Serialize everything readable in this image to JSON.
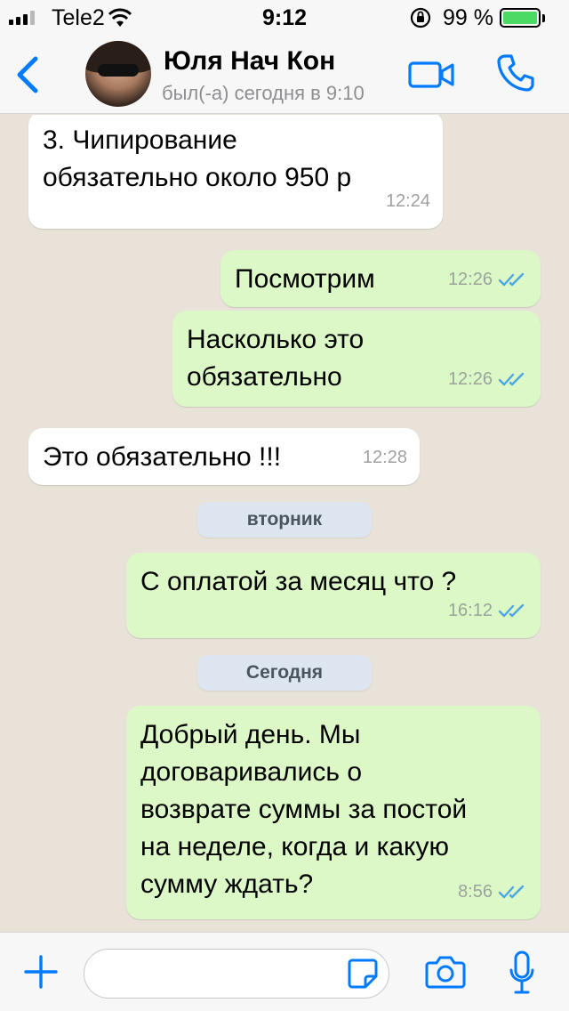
{
  "status_bar": {
    "carrier": "Tele2",
    "time": "9:12",
    "battery_percent": "99 %",
    "battery_level": 0.99
  },
  "header": {
    "contact_name": "Юля Нач Кон",
    "contact_status": "был(-а) сегодня в 9:10"
  },
  "messages": [
    {
      "direction": "in",
      "text": "3. Чипирование\nобязательно около 950 р",
      "time": "12:24"
    },
    {
      "direction": "out",
      "text": "Посмотрим",
      "time": "12:26",
      "read": true
    },
    {
      "direction": "out",
      "text": "Насколько это\nобязательно",
      "time": "12:26",
      "read": true
    },
    {
      "direction": "in",
      "text": "Это обязательно !!!",
      "time": "12:28"
    },
    {
      "direction": "out",
      "text": "С оплатой за месяц что ?",
      "time": "16:12",
      "read": true
    },
    {
      "direction": "out",
      "text": "Добрый день. Мы\nдоговаривались о\nвозврате суммы за постой\nна неделе, когда и какую\nсумму ждать?",
      "time": "8:56",
      "read": true
    }
  ],
  "day_separators": {
    "tuesday": "вторник",
    "today": "Сегодня"
  },
  "input": {
    "value": "",
    "placeholder": ""
  },
  "icons": {
    "back": "chevron-left-icon",
    "video": "video-camera-icon",
    "call": "phone-icon",
    "plus": "plus-icon",
    "sticker": "sticker-icon",
    "camera": "camera-icon",
    "mic": "microphone-icon"
  },
  "colors": {
    "accent": "#007aff",
    "outgoing_bubble": "#dcf8c6",
    "incoming_bubble": "#ffffff",
    "read_ticks": "#4fa6e6",
    "chat_background": "#e8e2d8",
    "day_pill": "#dde6f0"
  }
}
